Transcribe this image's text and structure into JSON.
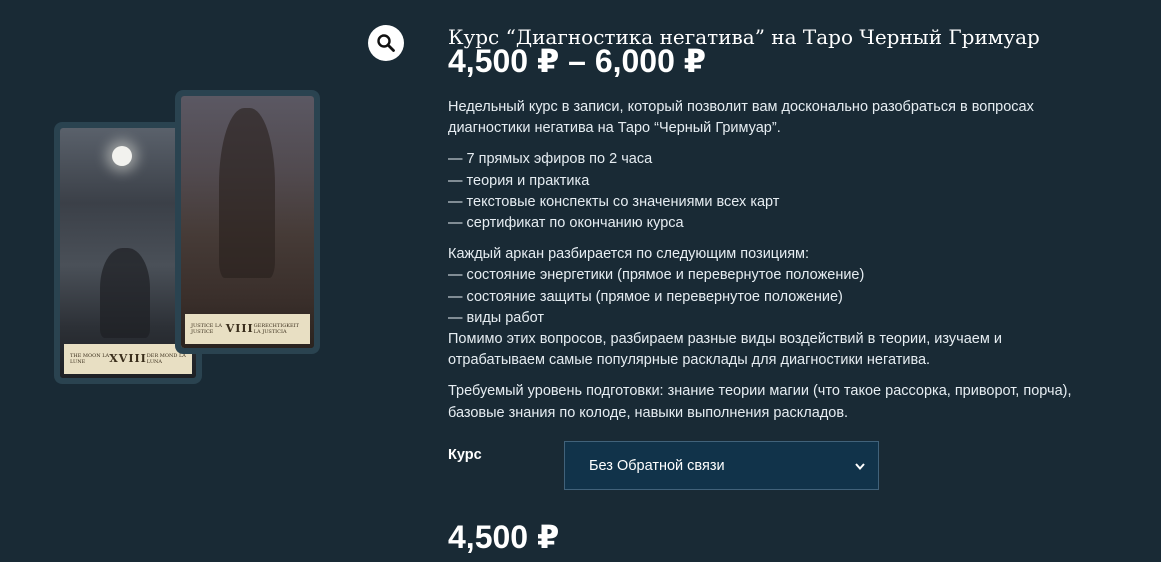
{
  "product": {
    "title": "Курс “Диагностика негатива” на Таро Черный Гримуар",
    "price_range": "4,500 ₽ – 6,000 ₽",
    "description": {
      "intro": [
        "Недельный курс в записи, который позволит вам досконально разобраться в вопросах",
        "диагностики негатива на Таро “Черный Гримуар”."
      ],
      "features": [
        "— 7 прямых эфиров по 2 часа",
        "— теория и практика",
        "— текстовые конспекты со значениями всех карт",
        "— сертификат по окончанию курса"
      ],
      "positions": [
        "Каждый аркан разбирается по следующим позициям:",
        "— состояние энергетики (прямое и перевернутое положение)",
        "— состояние защиты (прямое и перевернутое положение)",
        "— виды работ",
        "Помимо этих вопросов, разбираем разные виды воздействий в теории, изучаем и",
        "отрабатываем самые популярные расклады для диагностики негатива."
      ],
      "requirements": [
        "Требуемый уровень подготовки: знание теории магии (что такое рассорка, приворот, порча),",
        "базовые знания по колоде, навыки выполнения раскладов."
      ]
    },
    "variation": {
      "label": "Курс",
      "selected": "Без Обратной связи"
    },
    "final_price": "4,500 ₽"
  },
  "gallery": {
    "zoom_icon": "magnifier-icon",
    "cards": [
      {
        "numeral": "XVIII",
        "left_caption": "THE MOON LA LUNE",
        "right_caption": "DER MOND LA LUNA"
      },
      {
        "numeral": "VIII",
        "left_caption": "JUSTICE LA JUSTICE",
        "right_caption": "GERECHTIGKEIT LA JUSTICIA"
      }
    ]
  },
  "colors": {
    "background": "#192a35",
    "select_bg": "#11334a",
    "text": "#ffffff"
  }
}
